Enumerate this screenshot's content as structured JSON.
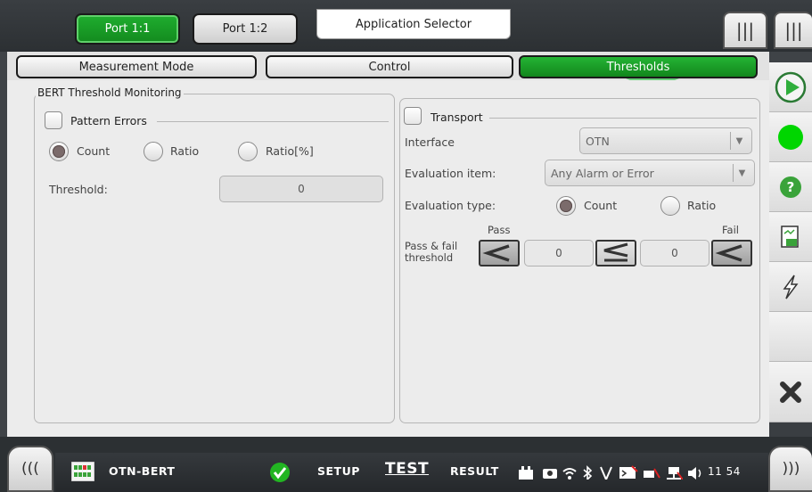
{
  "top": {
    "port_tabs": [
      "Port 1:1",
      "Port 1:2"
    ],
    "app_selector": "Application Selector",
    "menu_icon": "|||"
  },
  "subtabs": [
    "Measurement Mode",
    "Control",
    "Thresholds"
  ],
  "bert_group": {
    "legend": "BERT Threshold Monitoring",
    "pattern_errors": {
      "label": "Pattern Errors",
      "checked": false,
      "options": [
        "Count",
        "Ratio",
        "Ratio[%]"
      ],
      "selected": "Count",
      "threshold_label": "Threshold:",
      "threshold_value": "0"
    }
  },
  "transport_group": {
    "label": "Transport",
    "checked": false,
    "interface_label": "Interface",
    "interface_value": "OTN",
    "eval_item_label": "Evaluation item:",
    "eval_item_value": "Any Alarm or Error",
    "eval_type_label": "Evaluation type:",
    "eval_type_options": [
      "Count",
      "Ratio"
    ],
    "eval_type_selected": "Count",
    "pass_fail_label_line1": "Pass & fail",
    "pass_fail_label_line2": "threshold",
    "pass_label": "Pass",
    "fail_label": "Fail",
    "pass_value": "0",
    "fail_value": "0"
  },
  "sidebar": {
    "icons": [
      "play-icon",
      "status-led-icon",
      "help-icon",
      "report-icon",
      "lightning-icon",
      "close-icon"
    ],
    "led_color": "#00d600",
    "help_color": "#3aa33a"
  },
  "bottom": {
    "app_name": "OTN-BERT",
    "setup": "SETUP",
    "test": "TEST",
    "result": "RESULT",
    "time": "11 54",
    "left_nav": "(((",
    "right_nav": ")))"
  }
}
